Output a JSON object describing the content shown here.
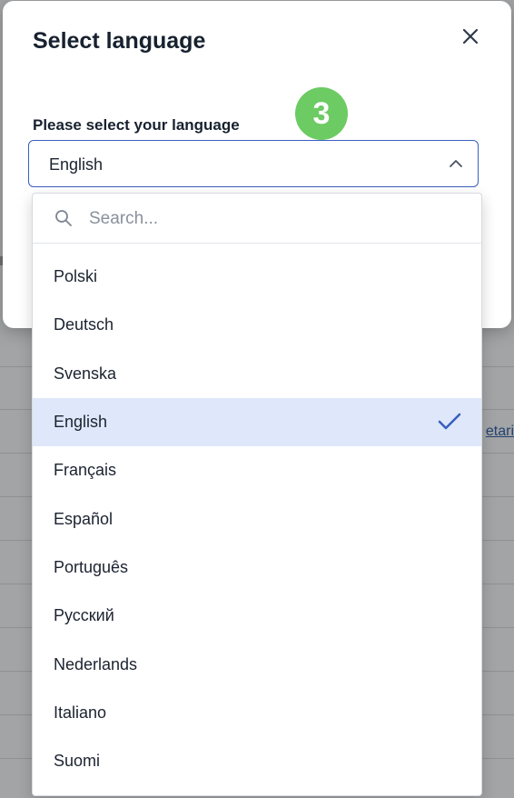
{
  "background": {
    "link_fragment": "etari"
  },
  "modal": {
    "title": "Select language",
    "field_label": "Please select your language",
    "step_badge": "3",
    "selected_value": "English"
  },
  "dropdown": {
    "search_placeholder": "Search...",
    "selected_index": 3,
    "items": [
      {
        "label": "Polski"
      },
      {
        "label": "Deutsch"
      },
      {
        "label": "Svenska"
      },
      {
        "label": "English"
      },
      {
        "label": "Français"
      },
      {
        "label": "Español"
      },
      {
        "label": "Português"
      },
      {
        "label": "Русский"
      },
      {
        "label": "Nederlands"
      },
      {
        "label": "Italiano"
      },
      {
        "label": "Suomi"
      }
    ]
  },
  "colors": {
    "accent": "#3a5fc0",
    "selected_row": "#dfe8fa",
    "badge": "#6ccb63"
  }
}
